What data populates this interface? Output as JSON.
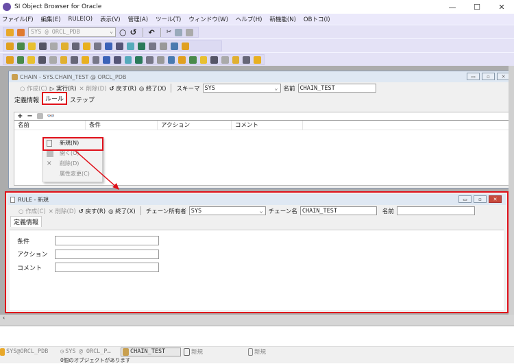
{
  "app": {
    "title": "SI Object Browser for Oracle"
  },
  "menu": [
    "ファイル(F)",
    "編集(E)",
    "RULE(O)",
    "表示(V)",
    "管理(A)",
    "ツール(T)",
    "ウィンドウ(W)",
    "ヘルプ(H)",
    "新機能(N)",
    "OBトコ(I)"
  ],
  "toolbar": {
    "connection": "SYS @ ORCL_PDB"
  },
  "chain_window": {
    "title": "CHAIN - SYS.CHAIN_TEST @ ORCL_PDB",
    "create": "作成(C)",
    "run": "実行(R)",
    "delete": "削除(D)",
    "revert": "戻す(R)",
    "close": "終了(X)",
    "schema_label": "スキーマ",
    "schema_value": "SYS",
    "name_label": "名前",
    "name_value": "CHAIN_TEST",
    "tabs": [
      "定義情報",
      "ルール",
      "ステップ"
    ],
    "columns": [
      "名前",
      "条件",
      "アクション",
      "コメント"
    ]
  },
  "context_menu": [
    "新規(N)",
    "開く(O)",
    "削除(D)",
    "属性変更(C)"
  ],
  "rule_window": {
    "title": "RULE - 新規",
    "create": "作成(C)",
    "delete": "削除(D)",
    "revert": "戻す(R)",
    "close": "終了(X)",
    "owner_label": "チェーン所有者",
    "owner_value": "SYS",
    "chain_label": "チェーン名",
    "chain_value": "CHAIN_TEST",
    "name_label": "名前",
    "name_value": "",
    "tab": "定義情報",
    "fields": [
      "条件",
      "アクション",
      "コメント"
    ]
  },
  "taskbar": [
    "SYS@ORCL_PDB",
    "SYS @ ORCL_P…",
    "CHAIN_TEST",
    "新規",
    "新規"
  ],
  "status": "0個のオブジェクトがあります",
  "colors": {
    "highlight": "#e0101a",
    "menu_bg": "#ebe9fb"
  }
}
